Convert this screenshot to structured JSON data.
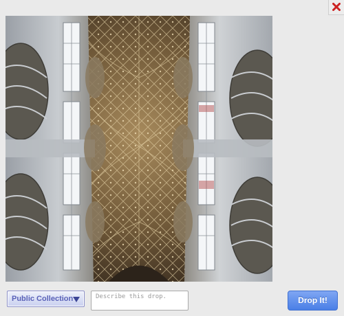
{
  "header": {
    "close_icon": "close-icon",
    "close_color": "#cc2222"
  },
  "photo": {
    "subject": "cathedral-fan-vaulted-ceiling-photo"
  },
  "toolbar": {
    "collection_select": {
      "selected": "Public Collection",
      "icon": "dropdown-arrow-icon",
      "color": "#5a62b8"
    },
    "description": {
      "placeholder": "Describe this drop.",
      "value": ""
    },
    "drop_button": {
      "label": "Drop It!",
      "color": "#5d8ef0"
    }
  }
}
